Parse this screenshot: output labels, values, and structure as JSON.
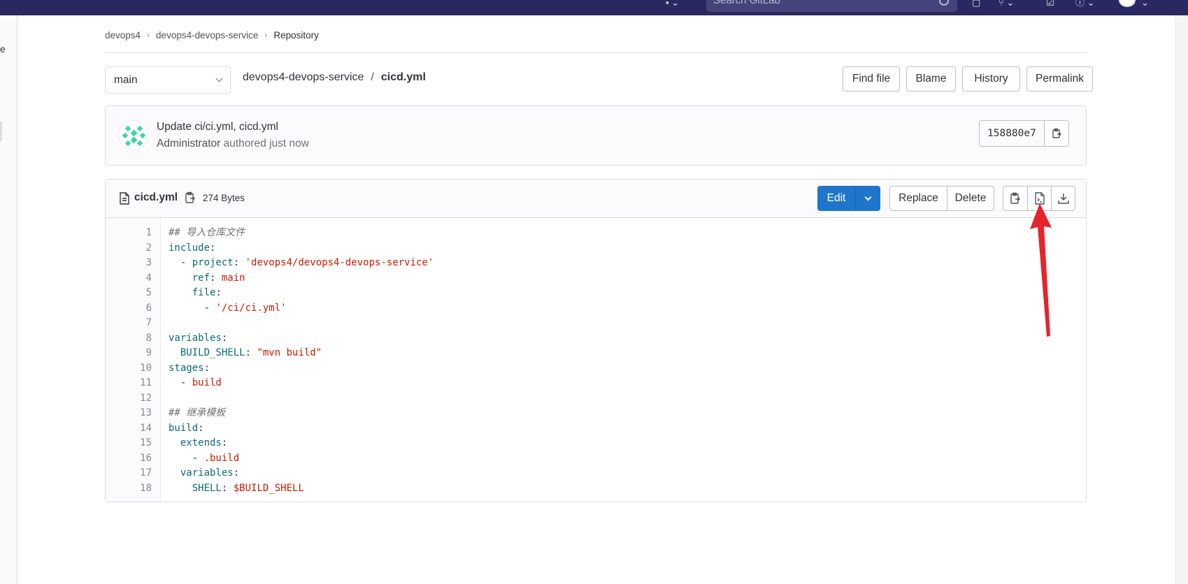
{
  "topbar": {
    "search_placeholder": "Search GitLab"
  },
  "left_edge_text": "e",
  "breadcrumb": [
    "devops4",
    "devops4-devops-service",
    "Repository"
  ],
  "branch": {
    "name": "main"
  },
  "file_path": {
    "repo": "devops4-devops-service",
    "separator": "/",
    "file": "cicd.yml"
  },
  "path_actions": [
    "Find file",
    "Blame",
    "History",
    "Permalink"
  ],
  "commit": {
    "title": "Update ci/ci.yml, cicd.yml",
    "author": "Administrator",
    "time_text": "authored just now",
    "sha": "158880e7"
  },
  "file": {
    "name": "cicd.yml",
    "size": "274 Bytes",
    "edit_label": "Edit",
    "replace_label": "Replace",
    "delete_label": "Delete"
  },
  "code_lines": [
    [
      {
        "t": "## 导入仓库文件",
        "c": "cm"
      }
    ],
    [
      {
        "t": "include",
        "c": "key"
      },
      {
        "t": ":",
        "c": "pun"
      }
    ],
    [
      {
        "t": "  - ",
        "c": "pun"
      },
      {
        "t": "project",
        "c": "key"
      },
      {
        "t": ": ",
        "c": "pun"
      },
      {
        "t": "'devops4/devops4-devops-service'",
        "c": "str"
      }
    ],
    [
      {
        "t": "    ",
        "c": "pun"
      },
      {
        "t": "ref",
        "c": "key"
      },
      {
        "t": ": ",
        "c": "pun"
      },
      {
        "t": "main",
        "c": "val"
      }
    ],
    [
      {
        "t": "    ",
        "c": "pun"
      },
      {
        "t": "file",
        "c": "key"
      },
      {
        "t": ":",
        "c": "pun"
      }
    ],
    [
      {
        "t": "      - ",
        "c": "pun"
      },
      {
        "t": "'/ci/ci.yml'",
        "c": "str"
      }
    ],
    [],
    [
      {
        "t": "variables",
        "c": "key"
      },
      {
        "t": ":",
        "c": "pun"
      }
    ],
    [
      {
        "t": "  ",
        "c": "pun"
      },
      {
        "t": "BUILD_SHELL",
        "c": "key"
      },
      {
        "t": ": ",
        "c": "pun"
      },
      {
        "t": "\"mvn build\"",
        "c": "str"
      }
    ],
    [
      {
        "t": "stages",
        "c": "key"
      },
      {
        "t": ":",
        "c": "pun"
      }
    ],
    [
      {
        "t": "  - ",
        "c": "pun"
      },
      {
        "t": "build",
        "c": "val"
      }
    ],
    [],
    [
      {
        "t": "## 继承模板",
        "c": "cm"
      }
    ],
    [
      {
        "t": "build",
        "c": "key"
      },
      {
        "t": ":",
        "c": "pun"
      }
    ],
    [
      {
        "t": "  ",
        "c": "pun"
      },
      {
        "t": "extends",
        "c": "key"
      },
      {
        "t": ":",
        "c": "pun"
      }
    ],
    [
      {
        "t": "    - ",
        "c": "pun"
      },
      {
        "t": ".build",
        "c": "val"
      }
    ],
    [
      {
        "t": "  ",
        "c": "pun"
      },
      {
        "t": "variables",
        "c": "key"
      },
      {
        "t": ":",
        "c": "pun"
      }
    ],
    [
      {
        "t": "    ",
        "c": "pun"
      },
      {
        "t": "SHELL",
        "c": "key"
      },
      {
        "t": ": ",
        "c": "pun"
      },
      {
        "t": "$BUILD_SHELL",
        "c": "val"
      }
    ]
  ],
  "colors": {
    "primary": "#1f75cb",
    "navbar": "#292961",
    "annotation": "#e8232a"
  },
  "icons": [
    "clipboard-icon",
    "file-icon",
    "download-icon",
    "raw-file-icon",
    "search-icon"
  ]
}
